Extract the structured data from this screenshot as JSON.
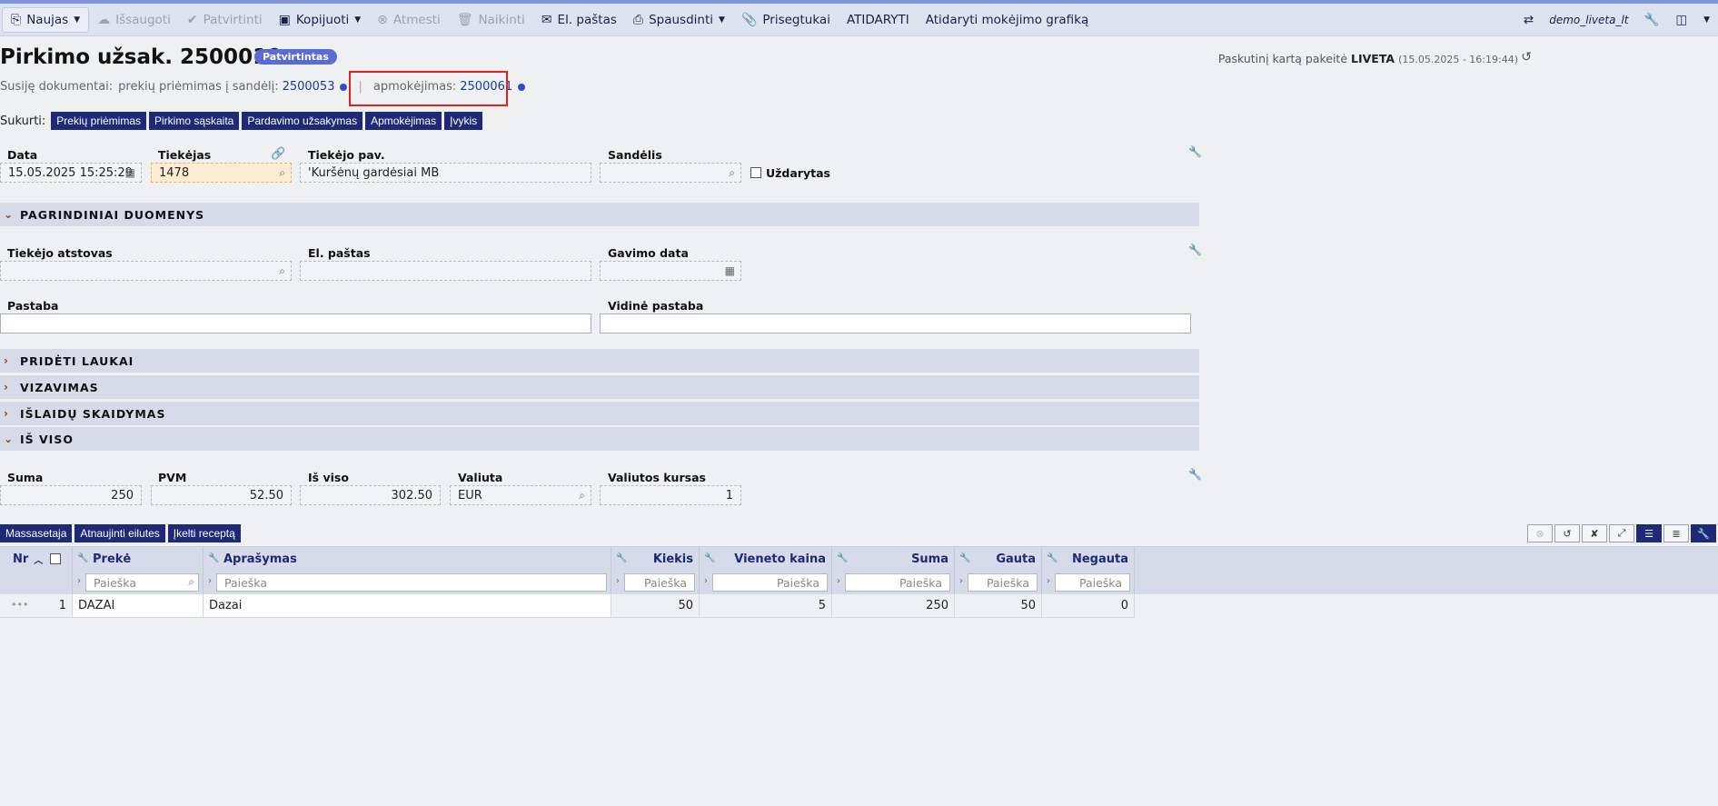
{
  "toolbar": {
    "new_label": "Naujas",
    "save_label": "Išsaugoti",
    "confirm_label": "Patvirtinti",
    "copy_label": "Kopijuoti",
    "reject_label": "Atmesti",
    "delete_label": "Naikinti",
    "email_label": "El. paštas",
    "print_label": "Spausdinti",
    "attachments_label": "Prisegtukai",
    "open_label": "ATIDARYTI",
    "open_schedule_label": "Atidaryti mokėjimo grafiką",
    "user": "demo_liveta_lt"
  },
  "header": {
    "title": "Pirkimo užsak. 2500010",
    "status": "Patvirtintas",
    "last_changed_prefix": "Paskutinį kartą pakeitė",
    "last_changed_user": "LIVETA",
    "last_changed_time": "(15.05.2025 - 16:19:44)"
  },
  "related": {
    "label": "Susiję dokumentai:",
    "receipt_label": "prekių priėmimas į sandėlį:",
    "receipt_link": "2500053",
    "payment_label": "apmokėjimas:",
    "payment_link": "2500061"
  },
  "create": {
    "label": "Sukurti:",
    "buttons": [
      "Prekių priėmimas",
      "Pirkimo sąskaita",
      "Pardavimo užsakymas",
      "Apmokėjimas",
      "Įvykis"
    ]
  },
  "fields": {
    "date_label": "Data",
    "date_value": "15.05.2025 15:25:29",
    "supplier_label": "Tiekėjas",
    "supplier_value": "1478",
    "supplier_name_label": "Tiekėjo pav.",
    "supplier_name_value": "'Kuršėnų gardėsiai MB",
    "warehouse_label": "Sandėlis",
    "warehouse_value": "",
    "closed_label": "Uždarytas"
  },
  "sections": {
    "main": "PAGRINDINIAI DUOMENYS",
    "extra": "PRIDĖTI LAUKAI",
    "approval": "VIZAVIMAS",
    "costs": "IŠLAIDŲ SKAIDYMAS",
    "totals": "IŠ VISO"
  },
  "main": {
    "rep_label": "Tiekėjo atstovas",
    "rep_value": "",
    "email_label": "El. paštas",
    "email_value": "",
    "receive_date_label": "Gavimo data",
    "receive_date_value": "",
    "note_label": "Pastaba",
    "note_value": "",
    "internal_note_label": "Vidinė pastaba",
    "internal_note_value": ""
  },
  "totals": {
    "sum_label": "Suma",
    "sum_value": "250",
    "vat_label": "PVM",
    "vat_value": "52.50",
    "total_label": "Iš viso",
    "total_value": "302.50",
    "currency_label": "Valiuta",
    "currency_value": "EUR",
    "rate_label": "Valiutos kursas",
    "rate_value": "1"
  },
  "grid_actions": [
    "Massasetaja",
    "Atnaujinti eilutes",
    "Įkelti receptą"
  ],
  "grid": {
    "columns": [
      "Nr",
      "Prekė",
      "Aprašymas",
      "Kiekis",
      "Vieneto kaina",
      "Suma",
      "Gauta",
      "Negauta"
    ],
    "filter_placeholder": "Paieška",
    "rows": [
      {
        "nr": "1",
        "item": "DAZAI",
        "description": "Dazai",
        "qty": "50",
        "unit_price": "5",
        "sum": "250",
        "received": "50",
        "not_received": "0"
      }
    ]
  }
}
